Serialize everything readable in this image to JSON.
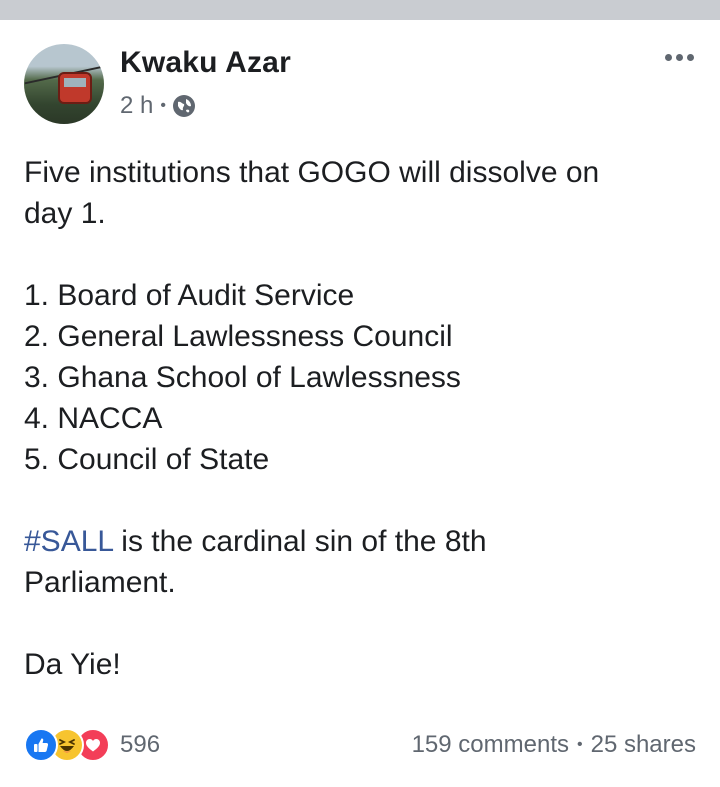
{
  "post": {
    "author": "Kwaku Azar",
    "time": "2 h",
    "separator": "•",
    "privacy_icon": "globe-icon",
    "more_icon": "more-options-icon",
    "body": {
      "intro_line1": "Five institutions that GOGO will dissolve on",
      "intro_line2": "day 1.",
      "list": [
        "1. Board of Audit Service",
        "2. General Lawlessness Council",
        "3. Ghana School of Lawlessness",
        "4. NACCA",
        "5. Council of State"
      ],
      "hashtag": "#SALL",
      "hashtag_rest": " is the cardinal sin of the 8th",
      "hashtag_line2": "Parliament.",
      "closing": "Da Yie!"
    },
    "reactions": {
      "icons": [
        "like-icon",
        "haha-icon",
        "love-icon"
      ],
      "count": "596"
    },
    "stats": {
      "comments": "159 comments",
      "separator": "•",
      "shares": "25 shares"
    },
    "colors": {
      "link": "#385898",
      "secondary_text": "#606770",
      "like": "#1877f2",
      "haha": "#f7c42f",
      "love": "#f33e58"
    }
  }
}
